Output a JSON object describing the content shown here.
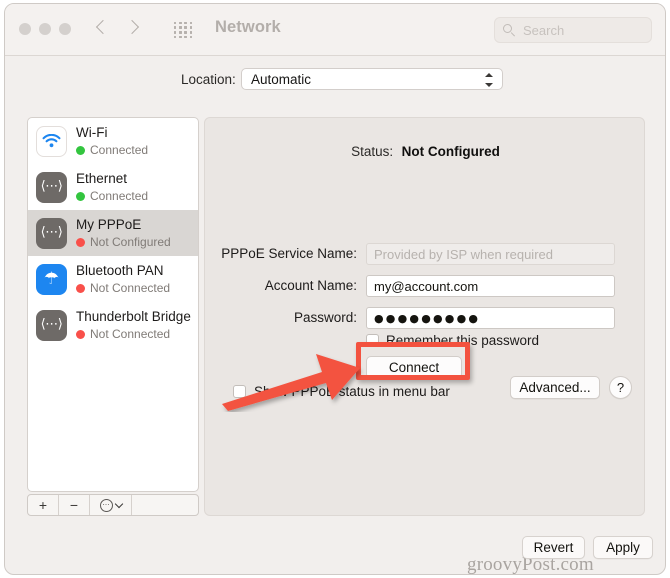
{
  "window": {
    "title": "Network",
    "traffic_lights": [
      "close",
      "minimize",
      "zoom"
    ],
    "nav": {
      "back": "back-chevron",
      "forward": "forward-chevron"
    },
    "grid_icon": "show-all-icon",
    "search": {
      "placeholder": "Search",
      "value": "",
      "icon": "search-icon"
    }
  },
  "location": {
    "label": "Location:",
    "value": "Automatic",
    "options": [
      "Automatic"
    ]
  },
  "sidebar": {
    "services": [
      {
        "name": "Wi-Fi",
        "status": "Connected",
        "state": "connected",
        "icon": "wifi-icon",
        "selected": false
      },
      {
        "name": "Ethernet",
        "status": "Connected",
        "state": "connected",
        "icon": "ethernet-icon",
        "selected": false
      },
      {
        "name": "My PPPoE",
        "status": "Not Configured",
        "state": "not-connected",
        "icon": "ethernet-icon",
        "selected": true
      },
      {
        "name": "Bluetooth PAN",
        "status": "Not Connected",
        "state": "not-connected",
        "icon": "bluetooth-icon",
        "selected": false
      },
      {
        "name": "Thunderbolt Bridge",
        "status": "Not Connected",
        "state": "not-connected",
        "icon": "ethernet-icon",
        "selected": false
      }
    ],
    "toolbar": {
      "add": "+",
      "remove": "−",
      "options": "⋯",
      "options_icon": "actions-gear-icon"
    }
  },
  "main": {
    "status_label": "Status:",
    "status_value": "Not Configured",
    "fields": [
      {
        "label": "PPPoE Service Name:",
        "value": "",
        "placeholder": "Provided by ISP when required",
        "type": "text",
        "disabled": true
      },
      {
        "label": "Account Name:",
        "value": "my@account.com",
        "placeholder": "",
        "type": "text",
        "disabled": false
      },
      {
        "label": "Password:",
        "value": "●●●●●●●●●",
        "placeholder": "",
        "type": "password",
        "disabled": false
      }
    ],
    "remember_password": {
      "label": "Remember this password",
      "checked": false
    },
    "connect_button": "Connect",
    "watermark": "groovyPost.com",
    "menu_bar_checkbox": {
      "label": "Show PPPoE status in menu bar",
      "checked": false
    },
    "advanced_button": "Advanced...",
    "help_button": "?"
  },
  "footer": {
    "revert": "Revert",
    "apply": "Apply"
  },
  "annotations": {
    "highlight_target": "Connect",
    "arrow_color": "#f3523f",
    "highlight_color": "#f3523f"
  },
  "colors": {
    "connected": "#33c53f",
    "not_connected": "#f9504a",
    "accent_red": "#f3523f",
    "window_bg": "#f2efed",
    "panel_bg": "#eae6e3"
  }
}
